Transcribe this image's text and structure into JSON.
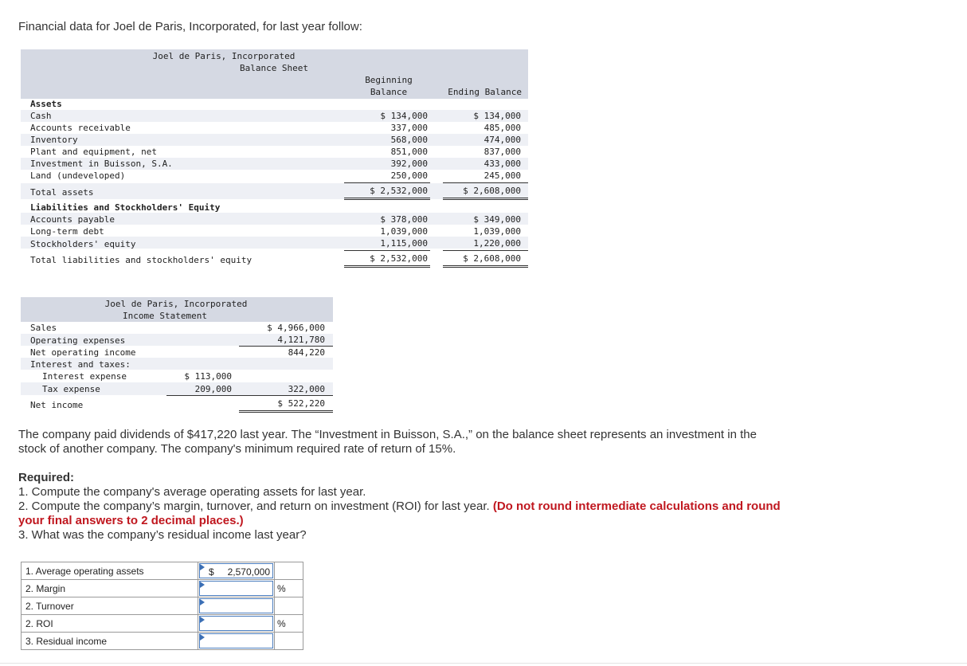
{
  "intro": "Financial data for Joel de Paris, Incorporated, for last year follow:",
  "balance_sheet": {
    "company": "Joel de Paris, Incorporated",
    "title": "Balance Sheet",
    "col_begin_1": "Beginning",
    "col_begin_2": "Balance",
    "col_end": "Ending Balance",
    "assets_header": "Assets",
    "rows": [
      {
        "label": "Cash",
        "begin": "$ 134,000",
        "end": "$ 134,000"
      },
      {
        "label": "Accounts receivable",
        "begin": "337,000",
        "end": "485,000"
      },
      {
        "label": "Inventory",
        "begin": "568,000",
        "end": "474,000"
      },
      {
        "label": "Plant and equipment, net",
        "begin": "851,000",
        "end": "837,000"
      },
      {
        "label": "Investment in Buisson, S.A.",
        "begin": "392,000",
        "end": "433,000"
      },
      {
        "label": "Land (undeveloped)",
        "begin": "250,000",
        "end": "245,000"
      }
    ],
    "total_assets": {
      "label": "Total assets",
      "begin": "$ 2,532,000",
      "end": "$ 2,608,000"
    },
    "liab_header": "Liabilities and Stockholders' Equity",
    "liab_rows": [
      {
        "label": "Accounts payable",
        "begin": "$ 378,000",
        "end": "$ 349,000"
      },
      {
        "label": "Long-term debt",
        "begin": "1,039,000",
        "end": "1,039,000"
      },
      {
        "label": "Stockholders' equity",
        "begin": "1,115,000",
        "end": "1,220,000"
      }
    ],
    "total_liab": {
      "label": "Total liabilities and stockholders' equity",
      "begin": "$ 2,532,000",
      "end": "$ 2,608,000"
    }
  },
  "income_statement": {
    "company": "Joel de Paris, Incorporated",
    "title": "Income Statement",
    "sales_label": "Sales",
    "sales": "$ 4,966,000",
    "opex_label": "Operating expenses",
    "opex": "4,121,780",
    "noi_label": "Net operating income",
    "noi": "844,220",
    "it_label": "Interest and taxes:",
    "interest_label": "Interest expense",
    "interest": "$ 113,000",
    "tax_label": "Tax expense",
    "tax": "209,000",
    "it_total": "322,000",
    "ni_label": "Net income",
    "ni": "$ 522,220"
  },
  "paragraph": "The company paid dividends of $417,220 last year. The “Investment in Buisson, S.A.,” on the balance sheet represents an investment in the stock of another company. The company's minimum required rate of return of 15%.",
  "required": {
    "heading": "Required:",
    "q1": "1. Compute the company's average operating assets for last year.",
    "q2": "2. Compute the company’s margin, turnover, and return on investment (ROI) for last year.",
    "q2_note": "(Do not round intermediate calculations and round your final answers to 2 decimal places.)",
    "q3": "3. What was the company’s residual income last year?"
  },
  "answers": [
    {
      "label": "1. Average operating assets",
      "dollar": "$",
      "value": "2,570,000",
      "unit": ""
    },
    {
      "label": "2. Margin",
      "dollar": "",
      "value": "",
      "unit": "%"
    },
    {
      "label": "2. Turnover",
      "dollar": "",
      "value": "",
      "unit": ""
    },
    {
      "label": "2. ROI",
      "dollar": "",
      "value": "",
      "unit": "%"
    },
    {
      "label": "3. Residual income",
      "dollar": "",
      "value": "",
      "unit": ""
    }
  ]
}
